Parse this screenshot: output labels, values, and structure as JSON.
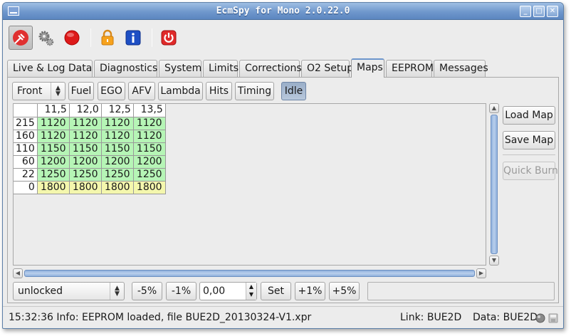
{
  "window": {
    "title": "EcmSpy for Mono 2.0.22.0"
  },
  "window_buttons": {
    "minimize": "_",
    "maximize": "□",
    "close": "✕"
  },
  "tabs": [
    "Live & Log Data",
    "Diagnostics",
    "System",
    "Limits",
    "Corrections",
    "O2 Setup",
    "Maps",
    "EEPROM",
    "Messages"
  ],
  "selected_tab": "Maps",
  "map_toolbar": {
    "cylinder_select": "Front",
    "buttons": [
      "Fuel",
      "EGO",
      "AFV",
      "Lambda",
      "Hits",
      "Timing",
      "Idle"
    ],
    "pressed": "Idle"
  },
  "map": {
    "columns": [
      "11,5",
      "12,0",
      "12,5",
      "13,5"
    ],
    "rows": [
      {
        "label": "215",
        "values": [
          "1120",
          "1120",
          "1120",
          "1120"
        ]
      },
      {
        "label": "160",
        "values": [
          "1120",
          "1120",
          "1120",
          "1120"
        ]
      },
      {
        "label": "110",
        "values": [
          "1150",
          "1150",
          "1150",
          "1150"
        ]
      },
      {
        "label": "60",
        "values": [
          "1200",
          "1200",
          "1200",
          "1200"
        ]
      },
      {
        "label": "22",
        "values": [
          "1250",
          "1250",
          "1250",
          "1250"
        ]
      },
      {
        "label": "0",
        "values": [
          "1800",
          "1800",
          "1800",
          "1800"
        ]
      }
    ],
    "colors": {
      "green": "#b6f5b6",
      "yellow": "#f4f7ad"
    }
  },
  "side_buttons": {
    "load": "Load Map",
    "save": "Save Map",
    "quick_burn": "Quick Burn"
  },
  "bottom_controls": {
    "lock_state": "unlocked",
    "minus5": "-5%",
    "minus1": "-1%",
    "value": "0,00",
    "set": "Set",
    "plus1": "+1%",
    "plus5": "+5%"
  },
  "status": {
    "message": "15:32:36 Info: EEPROM loaded, file BUE2D_20130324-V1.xpr",
    "link": "Link: BUE2D",
    "data": "Data: BUE2D"
  },
  "toolbar_icons": [
    "plug-icon",
    "gears-icon",
    "record-icon",
    "lock-icon",
    "info-icon",
    "power-icon"
  ]
}
